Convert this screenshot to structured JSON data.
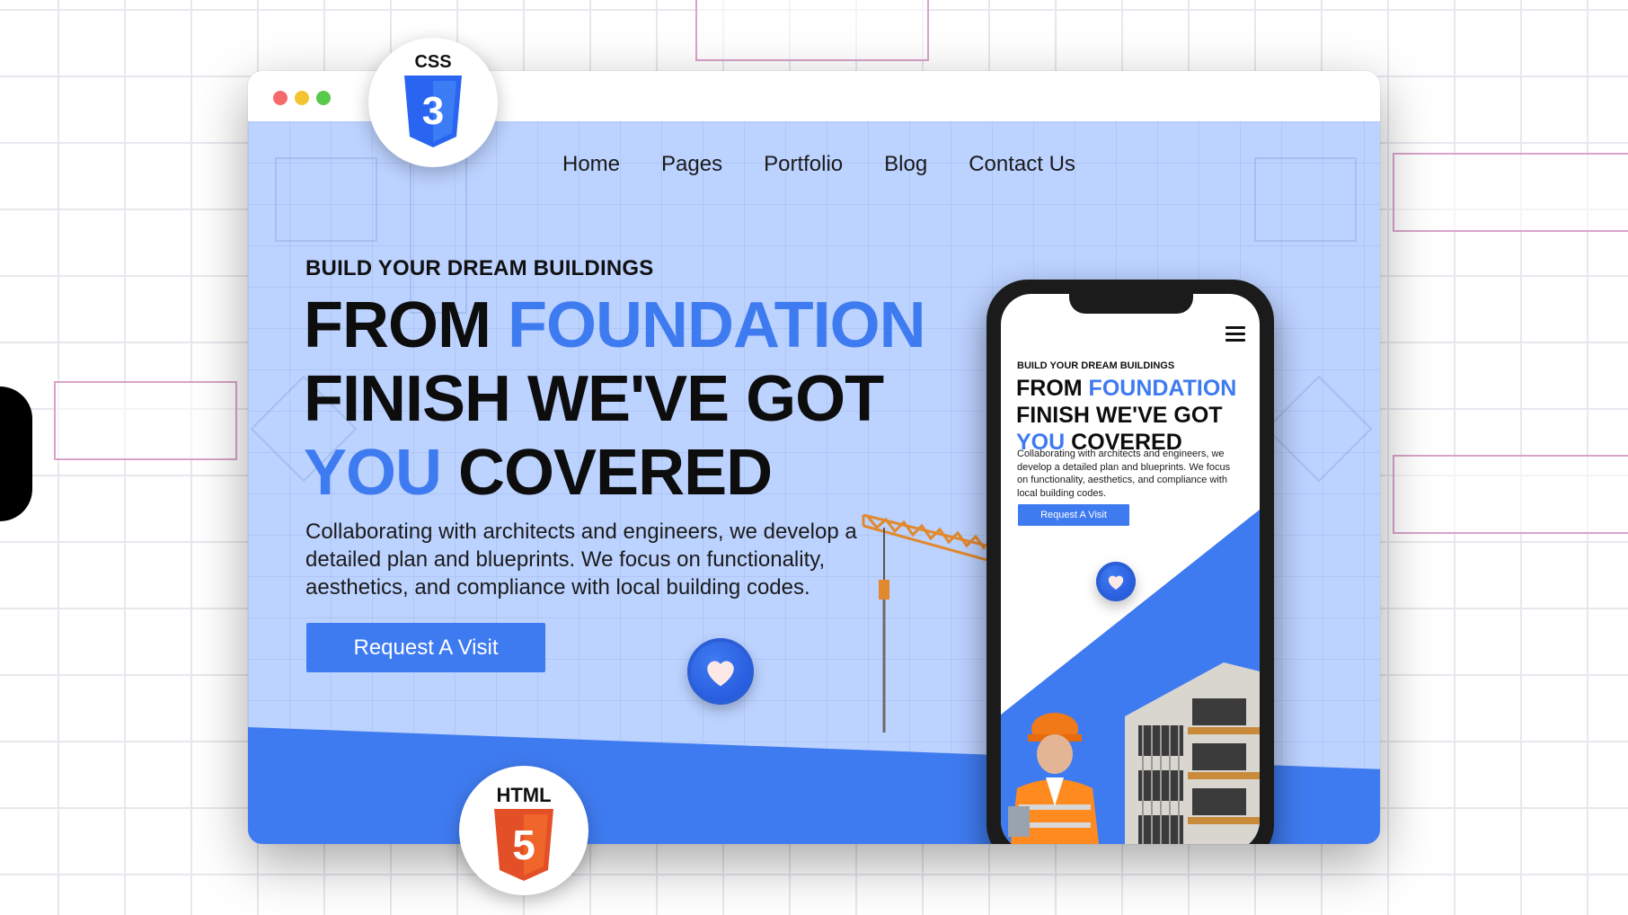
{
  "nav": {
    "items": [
      {
        "label": "Home"
      },
      {
        "label": "Pages"
      },
      {
        "label": "Portfolio"
      },
      {
        "label": "Blog"
      },
      {
        "label": "Contact Us"
      }
    ]
  },
  "hero": {
    "eyebrow": "BUILD YOUR DREAM BUILDINGS",
    "headline": {
      "line1_a": "FROM ",
      "line1_b": "FOUNDATION",
      "line2": "FINISH WE'VE GOT",
      "line3_a": "YOU",
      "line3_b": " COVERED"
    },
    "description": "Collaborating with architects and engineers, we develop a detailed plan and blueprints. We focus on functionality, aesthetics, and compliance with local building codes.",
    "cta_label": "Request A Visit"
  },
  "mobile": {
    "eyebrow": "BUILD YOUR DREAM BUILDINGS",
    "headline": {
      "line1_a": "FROM ",
      "line1_b": "FOUNDATION",
      "line2": "FINISH WE'VE GOT",
      "line3_a": "YOU",
      "line3_b": " COVERED"
    },
    "description": "Collaborating with architects and engineers, we develop a detailed plan and blueprints. We focus on functionality, aesthetics, and compliance with local building codes.",
    "cta_label": "Request A Visit"
  },
  "badges": {
    "css_label": "CSS",
    "css_number": "3",
    "html_label": "HTML",
    "html_number": "5"
  },
  "colors": {
    "accent": "#3f7bf0",
    "hero_bg": "#bcd2ff",
    "css_badge": "#2965f1",
    "html_badge": "#e34f26"
  },
  "icons": [
    "css3-logo-icon",
    "html5-logo-icon",
    "heart-icon",
    "hamburger-menu-icon",
    "crane-illustration"
  ]
}
